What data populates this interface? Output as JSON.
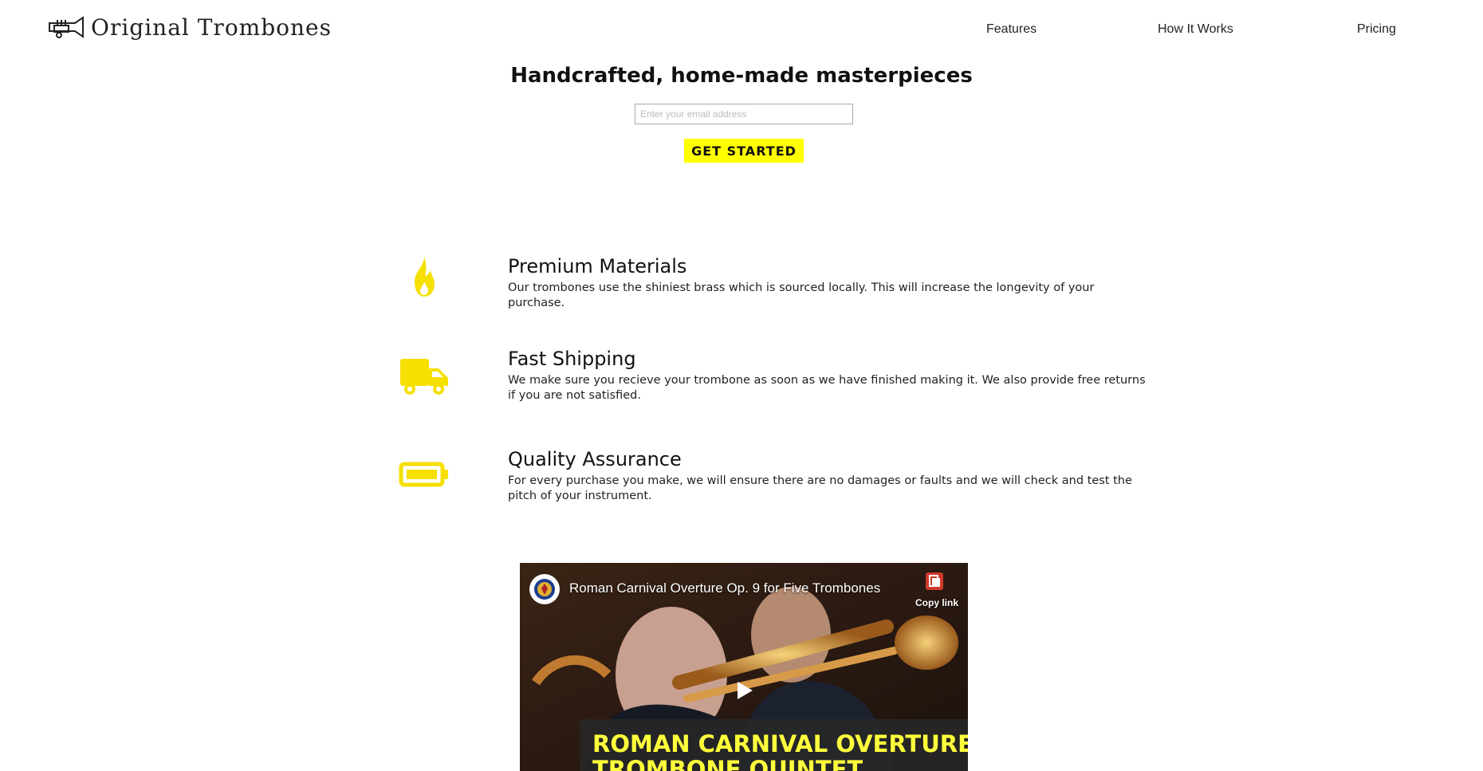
{
  "header": {
    "logo_text": "Original Trombones",
    "nav": [
      {
        "label": "Features"
      },
      {
        "label": "How It Works"
      },
      {
        "label": "Pricing"
      }
    ]
  },
  "hero": {
    "title": "Handcrafted, home-made masterpieces",
    "email_placeholder": "Enter your email address",
    "cta_label": "GET STARTED"
  },
  "features": [
    {
      "icon": "fire-icon",
      "title": "Premium Materials",
      "description": "Our trombones use the shiniest brass which is sourced locally. This will increase the longevity of your purchase."
    },
    {
      "icon": "truck-icon",
      "title": "Fast Shipping",
      "description": "We make sure you recieve your trombone as soon as we have finished making it. We also provide free returns if you are not satisfied."
    },
    {
      "icon": "battery-icon",
      "title": "Quality Assurance",
      "description": "For every purchase you make, we will ensure there are no damages or faults and we will check and test the pitch of your instrument."
    }
  ],
  "video": {
    "title": "Roman Carnival Overture Op. 9 for Five Trombones",
    "copy_link_label": "Copy link",
    "banner_line1": "ROMAN CARNIVAL OVERTURE",
    "banner_line2": "TROMBONE QUINTET"
  },
  "colors": {
    "accent": "#ffff00",
    "icon_yellow": "#f5e000"
  }
}
